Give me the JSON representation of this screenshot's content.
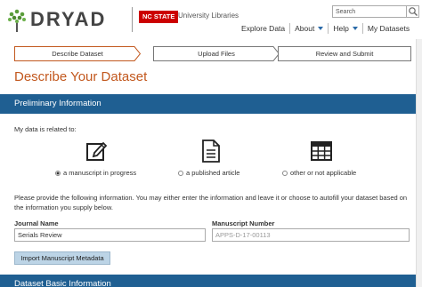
{
  "header": {
    "logo_text": "DRYAD",
    "ncstate_text": "NC STATE",
    "library_text": "University Libraries",
    "search_placeholder": "Search",
    "nav": [
      {
        "label": "Explore Data",
        "has_caret": false
      },
      {
        "label": "About",
        "has_caret": true
      },
      {
        "label": "Help",
        "has_caret": true
      },
      {
        "label": "My Datasets",
        "has_caret": false
      }
    ]
  },
  "steps": [
    {
      "label": "Describe Dataset",
      "active": true
    },
    {
      "label": "Upload Files",
      "active": false
    },
    {
      "label": "Review and Submit",
      "active": false
    }
  ],
  "page_title": "Describe Your Dataset",
  "preliminary": {
    "heading": "Preliminary Information",
    "related_label": "My data is related to:",
    "choices": [
      {
        "label": "a manuscript in progress",
        "icon": "edit-icon",
        "checked": true
      },
      {
        "label": "a published article",
        "icon": "document-icon",
        "checked": false
      },
      {
        "label": "other or not applicable",
        "icon": "table-icon",
        "checked": false
      }
    ],
    "instructions": "Please provide the following information. You may either enter the information and leave it or choose to autofill your dataset based on the information you supply below.",
    "journal_label": "Journal Name",
    "journal_value": "Serials Review",
    "manuscript_label": "Manuscript Number",
    "manuscript_placeholder": "APPS-D-17-00113",
    "import_button": "Import Manuscript Metadata"
  },
  "next_section_heading": "Dataset Basic Information",
  "colors": {
    "accent_orange": "#c2581e",
    "band_blue": "#1f5f92",
    "ncstate_red": "#cc0000",
    "button_blue": "#bcd4e6"
  }
}
